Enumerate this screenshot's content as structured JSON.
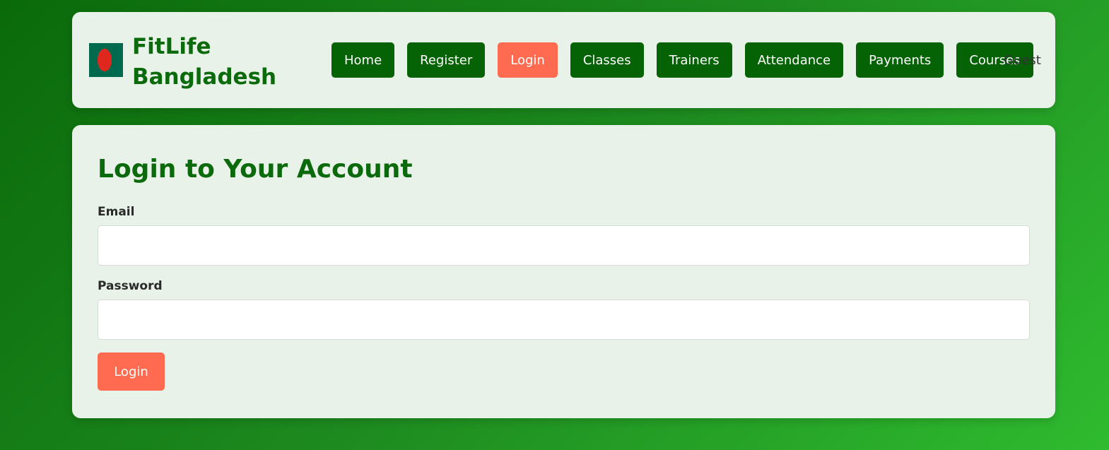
{
  "brand": {
    "line1": "FitLife",
    "line2": "Bangladesh",
    "flag_colors": {
      "field": "#006a4e",
      "disc": "#e0271e"
    }
  },
  "nav": {
    "items": [
      {
        "label": "Home",
        "active": false
      },
      {
        "label": "Register",
        "active": false
      },
      {
        "label": "Login",
        "active": true
      },
      {
        "label": "Classes",
        "active": false
      },
      {
        "label": "Trainers",
        "active": false
      },
      {
        "label": "Attendance",
        "active": false
      },
      {
        "label": "Payments",
        "active": false
      },
      {
        "label": "Courses",
        "active": false
      }
    ],
    "user_label": "Guest"
  },
  "login": {
    "title": "Login to Your Account",
    "email_label": "Email",
    "email_value": "",
    "password_label": "Password",
    "password_value": "",
    "submit_label": "Login"
  },
  "colors": {
    "primary_green": "#056205",
    "heading_green": "#0b6a0b",
    "accent_orange": "#ff6b50",
    "panel_bg": "#e8f2e8"
  }
}
